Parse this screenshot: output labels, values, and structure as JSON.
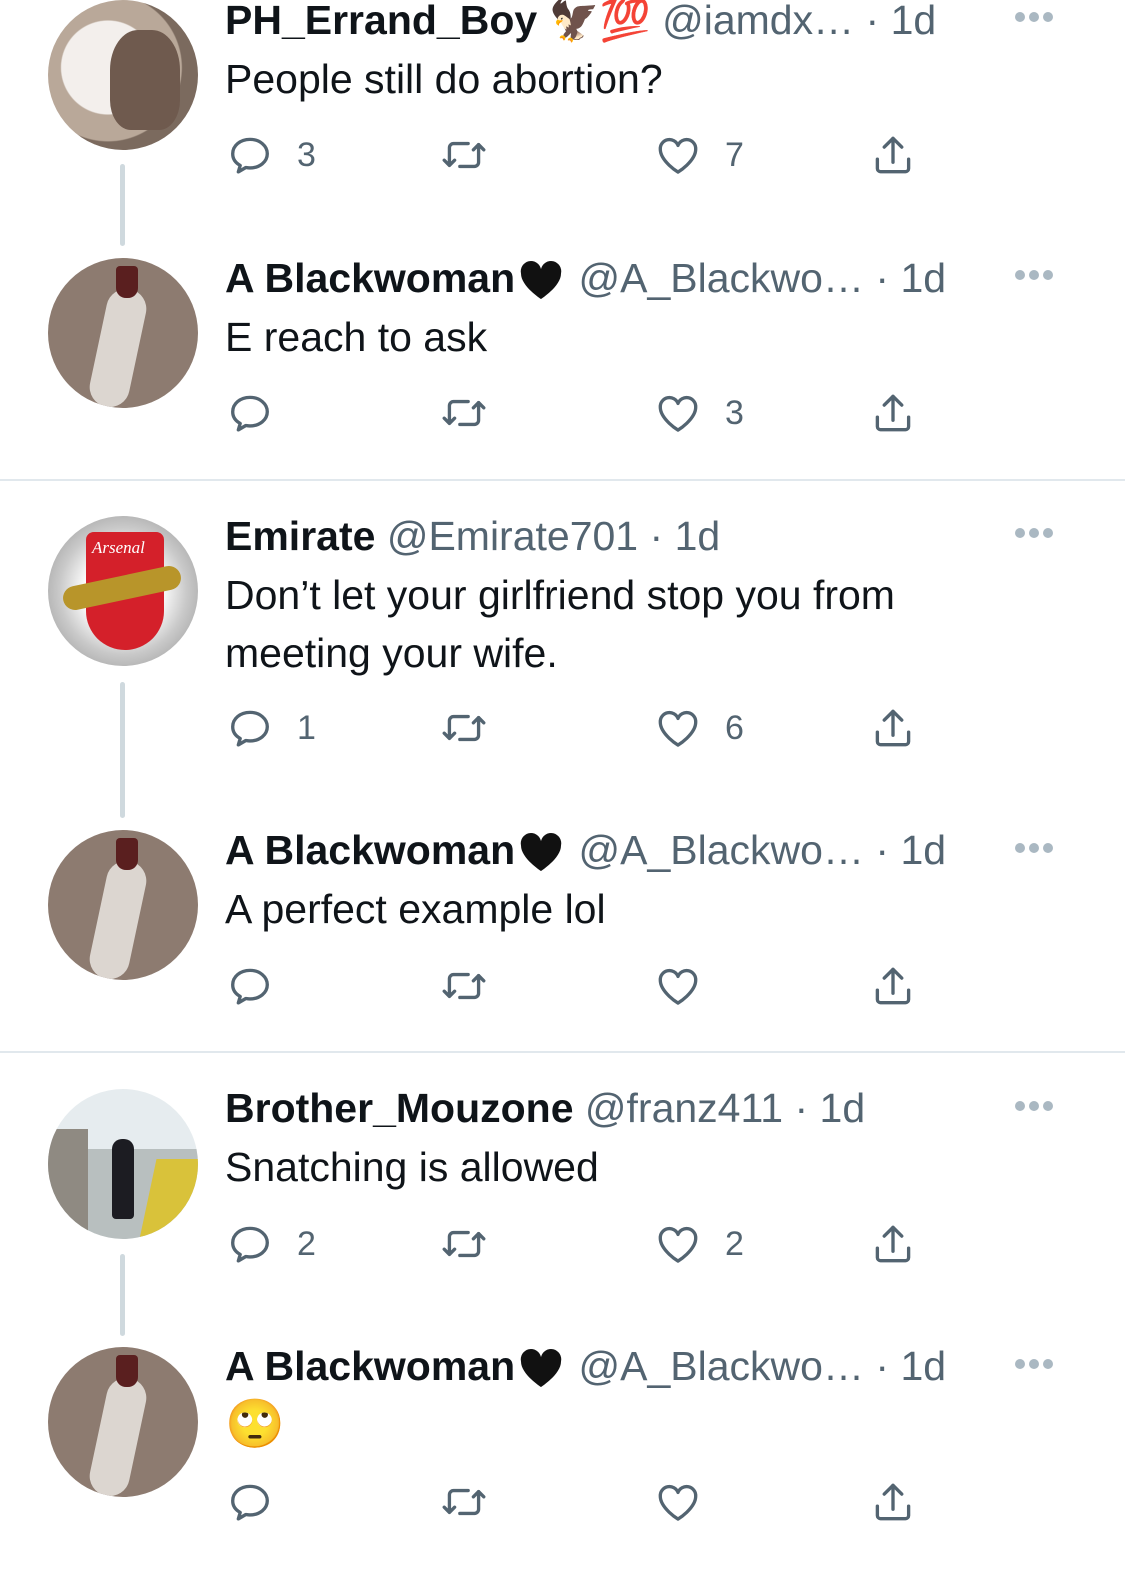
{
  "colors": {
    "text": "#0f1419",
    "secondary": "#536471",
    "divider": "#e1e8ed",
    "thread": "#cfd9de",
    "more_dots": "#aab8c2"
  },
  "tweets": [
    {
      "name": "PH_Errand_Boy",
      "name_emoji": "🦅💯",
      "handle": "@iamdx…",
      "dot": "·",
      "time": "1d",
      "text": "People still do abortion?",
      "replies": "3",
      "retweets": "",
      "likes": "7"
    },
    {
      "name": "A Blackwoman",
      "name_emoji": "🖤",
      "handle": "@A_Blackwo…",
      "dot": "·",
      "time": "1d",
      "text": "E reach to ask",
      "replies": "",
      "retweets": "",
      "likes": "3"
    },
    {
      "name": "Emirate",
      "name_emoji": "",
      "handle": "@Emirate701",
      "dot": "·",
      "time": "1d",
      "text": "Don’t let your girlfriend stop you from meeting your wife.",
      "replies": "1",
      "retweets": "",
      "likes": "6",
      "avatar_text": "Arsenal"
    },
    {
      "name": "A Blackwoman",
      "name_emoji": "🖤",
      "handle": "@A_Blackwo…",
      "dot": "·",
      "time": "1d",
      "text": "A perfect example lol",
      "replies": "",
      "retweets": "",
      "likes": ""
    },
    {
      "name": "Brother_Mouzone",
      "name_emoji": "",
      "handle": "@franz411",
      "dot": "·",
      "time": "1d",
      "text": "Snatching is allowed",
      "replies": "2",
      "retweets": "",
      "likes": "2"
    },
    {
      "name": "A Blackwoman",
      "name_emoji": "🖤",
      "handle": "@A_Blackwo…",
      "dot": "·",
      "time": "1d",
      "text": "🙄",
      "replies": "",
      "retweets": "",
      "likes": ""
    }
  ]
}
